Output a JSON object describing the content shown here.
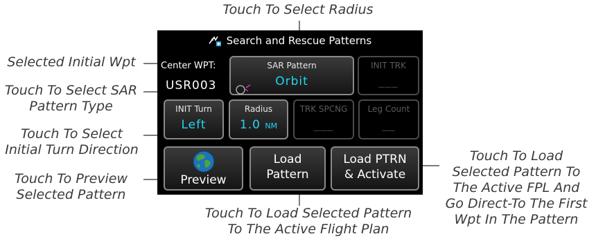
{
  "screen": {
    "title": "Search and Rescue Patterns",
    "center_wpt": {
      "label": "Center WPT:",
      "value": "USR003"
    },
    "sar_pattern": {
      "label": "SAR Pattern",
      "value": "Orbit"
    },
    "init_trk": {
      "label": "INIT TRK",
      "value": "___"
    },
    "init_turn": {
      "label": "INIT Turn",
      "value": "Left"
    },
    "radius": {
      "label": "Radius",
      "value": "1.0",
      "unit": "NM"
    },
    "trk_spcng": {
      "label": "TRK SPCNG",
      "value": "___"
    },
    "leg_count": {
      "label": "Leg Count",
      "value": "__"
    },
    "preview_label": "Preview",
    "load_pattern": {
      "line1": "Load",
      "line2": "Pattern"
    },
    "load_activate": {
      "line1": "Load PTRN",
      "line2": "& Activate"
    }
  },
  "callouts": {
    "radius": "Touch To Select Radius",
    "initial_wpt": "Selected Initial Wpt",
    "sar_type": {
      "line1": "Touch To Select SAR",
      "line2": "Pattern Type"
    },
    "turn_direction": {
      "line1": "Touch To Select",
      "line2": "Initial Turn Direction"
    },
    "preview": {
      "line1": "Touch To Preview",
      "line2": "Selected Pattern"
    },
    "load_pattern": {
      "line1": "Touch To Load Selected Pattern",
      "line2": "To The Active Flight Plan"
    },
    "load_activate": {
      "line1": "Touch To Load",
      "line2": "Selected Pattern To",
      "line3": "The Active FPL And",
      "line4": "Go Direct-To The First",
      "line5": "Wpt In The Pattern"
    }
  },
  "colors": {
    "value_cyan": "#21d6f2",
    "screen_bg": "#000000",
    "callout_text": "#3a3a3a"
  }
}
